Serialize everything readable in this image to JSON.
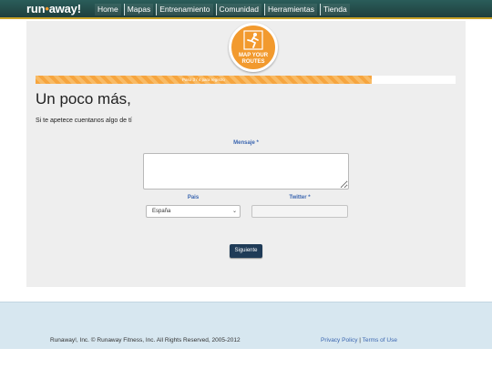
{
  "header": {
    "logo_left": "run",
    "logo_dot": "•",
    "logo_right": "away!",
    "nav": [
      {
        "label": "Home"
      },
      {
        "label": "Mapas"
      },
      {
        "label": "Entrenamiento"
      },
      {
        "label": "Comunidad"
      },
      {
        "label": "Herramientas"
      },
      {
        "label": "Tienda"
      }
    ]
  },
  "badge": {
    "line1": "MAP YOUR",
    "line2": "ROUTES",
    "icon": "runner-icon"
  },
  "progress": {
    "label": "Paso 3 / 4 para registro",
    "fraction": 0.8
  },
  "main": {
    "title": "Un poco más,",
    "subtitle": "Si te apetece cuentanos algo de tí"
  },
  "form": {
    "message_label": "Mensaje *",
    "message_value": "",
    "country_label": "Pais",
    "country_value": "España",
    "twitter_label": "Twitter *",
    "twitter_value": "",
    "next_label": "Siguiente"
  },
  "footer": {
    "copyright": "Runaway!, Inc. © Runaway Fitness, Inc. All Rights Reserved, 2005-2012",
    "privacy": "Privacy Policy",
    "separator": " | ",
    "terms": "Terms of Use"
  },
  "colors": {
    "header_bg": "#2a5d5a",
    "accent_orange": "#f29a2e",
    "button_bg": "#1f3b57",
    "label_blue": "#3b66b0",
    "footer_bg": "#d7e7f0"
  }
}
